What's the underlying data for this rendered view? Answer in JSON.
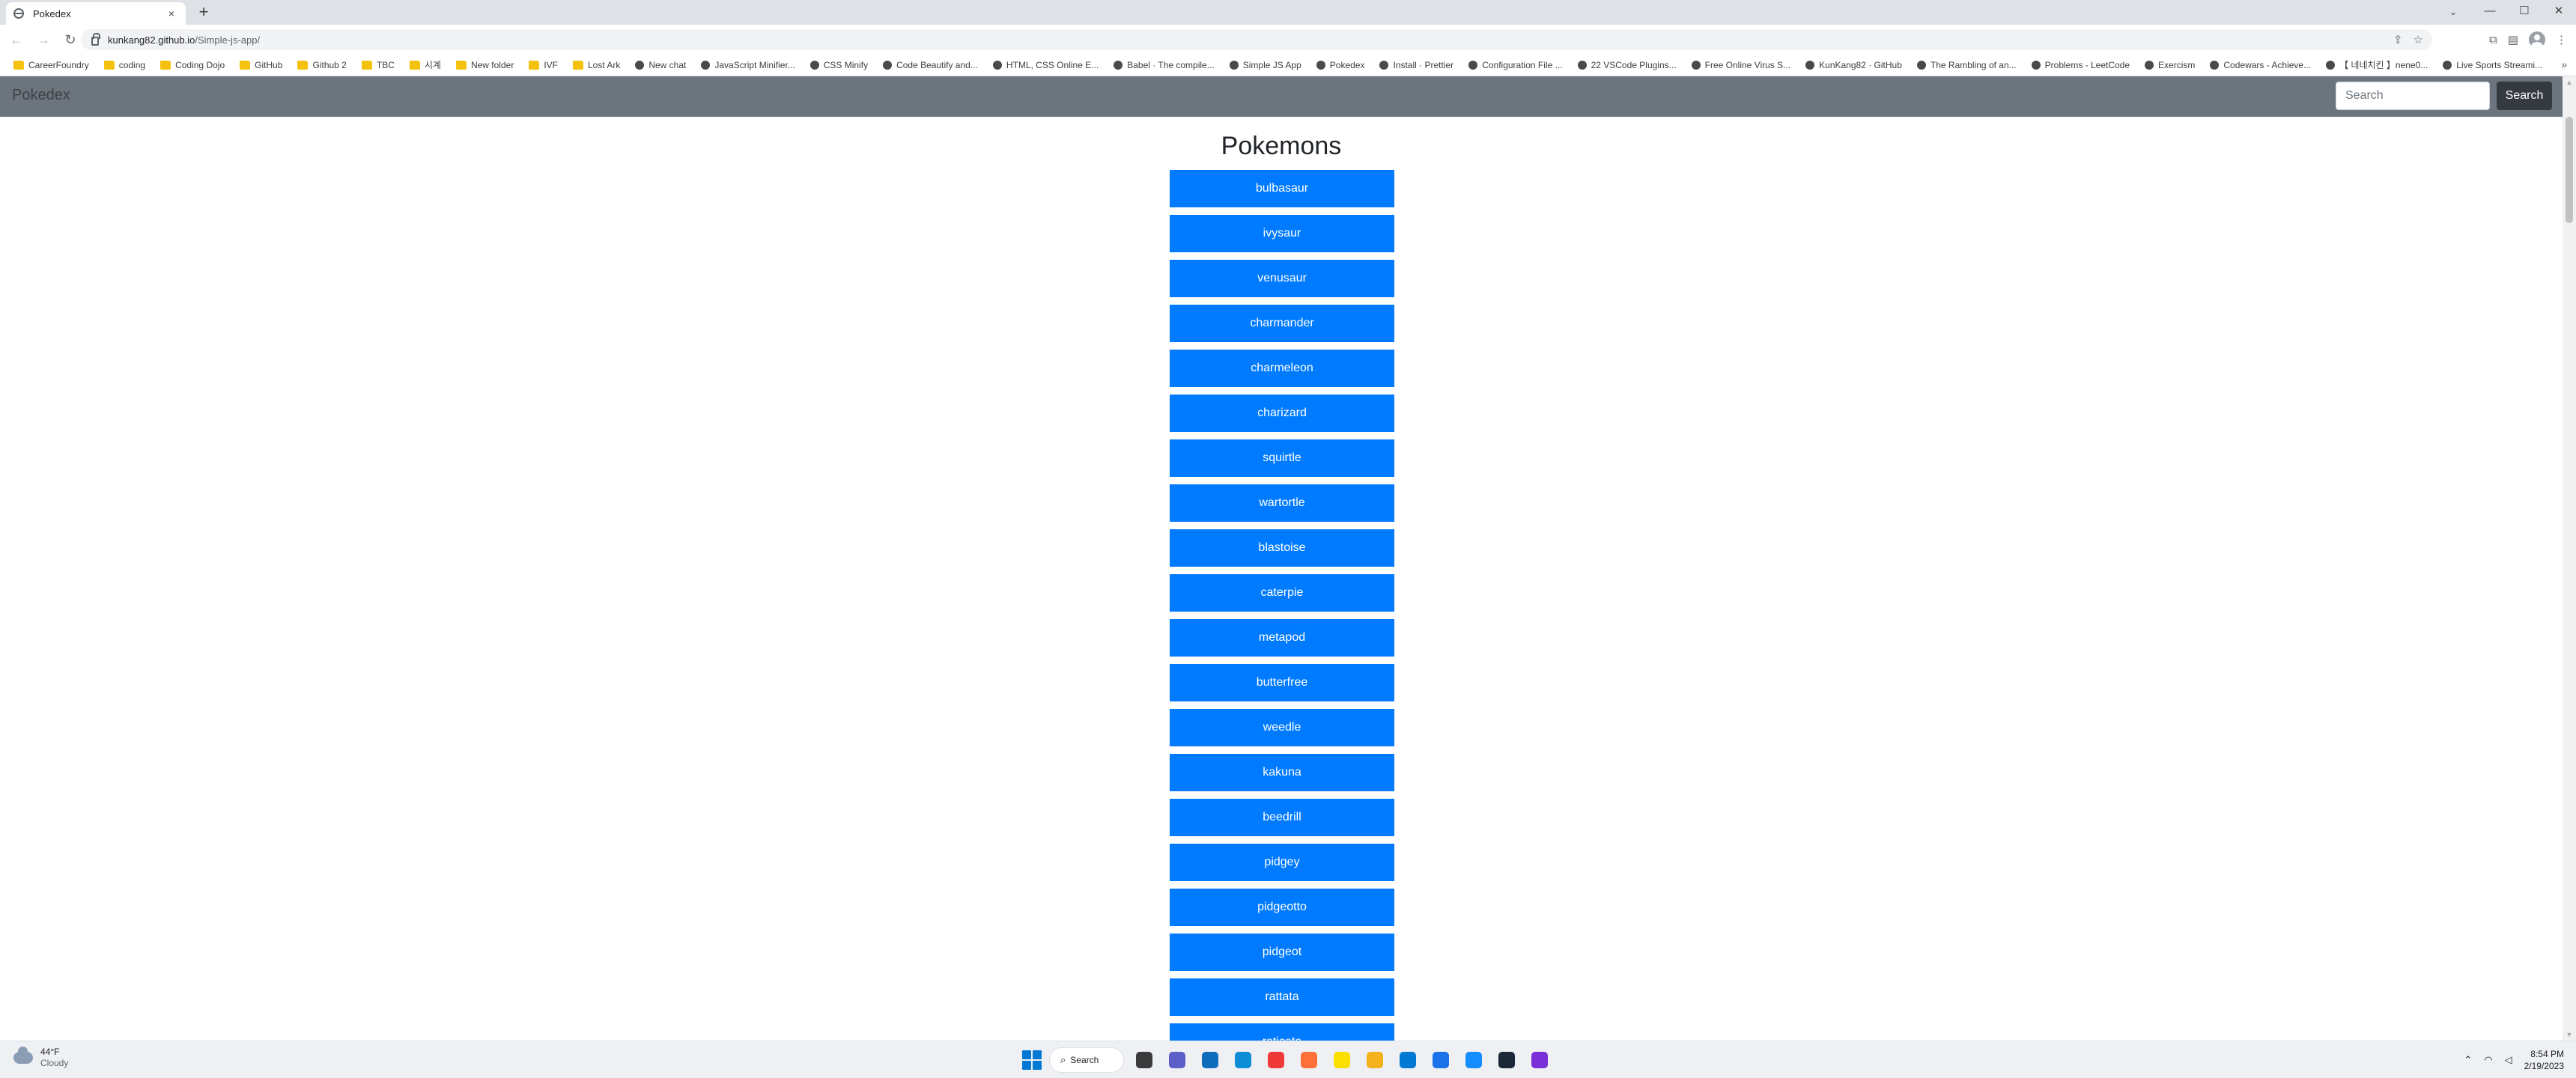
{
  "browser": {
    "tab_title": "Pokedex",
    "tab_close": "×",
    "new_tab": "+",
    "url_host": "kunkang82.github.io",
    "url_path": "/Simple-js-app/",
    "window_controls": {
      "tab_search": "⌄",
      "minimize": "—",
      "maximize": "☐",
      "close": "✕"
    },
    "nav": {
      "back": "←",
      "forward": "→",
      "reload": "↻"
    },
    "bookmarks": [
      {
        "label": "CareerFoundry",
        "icon": "folder"
      },
      {
        "label": "coding",
        "icon": "folder"
      },
      {
        "label": "Coding Dojo",
        "icon": "folder"
      },
      {
        "label": "GitHub",
        "icon": "folder"
      },
      {
        "label": "Github 2",
        "icon": "folder"
      },
      {
        "label": "TBC",
        "icon": "folder"
      },
      {
        "label": "시계",
        "icon": "folder"
      },
      {
        "label": "New folder",
        "icon": "folder"
      },
      {
        "label": "IVF",
        "icon": "folder"
      },
      {
        "label": "Lost Ark",
        "icon": "folder"
      },
      {
        "label": "New chat",
        "icon": "site"
      },
      {
        "label": "JavaScript Minifier...",
        "icon": "site"
      },
      {
        "label": "CSS Minify",
        "icon": "site"
      },
      {
        "label": "Code Beautify and...",
        "icon": "site"
      },
      {
        "label": "HTML, CSS Online E...",
        "icon": "site"
      },
      {
        "label": "Babel · The compile...",
        "icon": "site"
      },
      {
        "label": "Simple JS App",
        "icon": "site"
      },
      {
        "label": "Pokedex",
        "icon": "site"
      },
      {
        "label": "Install · Prettier",
        "icon": "site"
      },
      {
        "label": "Configuration File ...",
        "icon": "site"
      },
      {
        "label": "22 VSCode Plugins...",
        "icon": "site"
      },
      {
        "label": "Free Online Virus S...",
        "icon": "site"
      },
      {
        "label": "KunKang82 · GitHub",
        "icon": "site"
      },
      {
        "label": "The Rambling of an...",
        "icon": "site"
      },
      {
        "label": "Problems - LeetCode",
        "icon": "site"
      },
      {
        "label": "Exercism",
        "icon": "site"
      },
      {
        "label": "Codewars - Achieve...",
        "icon": "site"
      },
      {
        "label": "【 네네치킨 】nene0...",
        "icon": "site"
      },
      {
        "label": "Live Sports Streami...",
        "icon": "site"
      }
    ],
    "bookmarks_more": "»"
  },
  "page": {
    "brand": "Pokedex",
    "search_placeholder": "Search",
    "search_button": "Search",
    "heading": "Pokemons",
    "pokemons": [
      "bulbasaur",
      "ivysaur",
      "venusaur",
      "charmander",
      "charmeleon",
      "charizard",
      "squirtle",
      "wartortle",
      "blastoise",
      "caterpie",
      "metapod",
      "butterfree",
      "weedle",
      "kakuna",
      "beedrill",
      "pidgey",
      "pidgeotto",
      "pidgeot",
      "rattata",
      "raticate"
    ]
  },
  "taskbar": {
    "weather_temp": "44°F",
    "weather_condition": "Cloudy",
    "search_label": "Search",
    "time": "8:54 PM",
    "date": "2/19/2023",
    "apps": [
      "file-explorer",
      "teams",
      "store",
      "edge",
      "vivaldi",
      "firefox",
      "kakaotalk",
      "file-manager",
      "vscode",
      "chrome",
      "battlenet",
      "steam",
      "discord"
    ],
    "app_colors": [
      "#3a3a3a",
      "#5b5fc7",
      "#0f6cbd",
      "#0c8dd6",
      "#ef3939",
      "#ff7139",
      "#f9e000",
      "#f3b11b",
      "#0078d4",
      "#1a73e8",
      "#148eff",
      "#1b2838",
      "#7b2fd6"
    ]
  }
}
